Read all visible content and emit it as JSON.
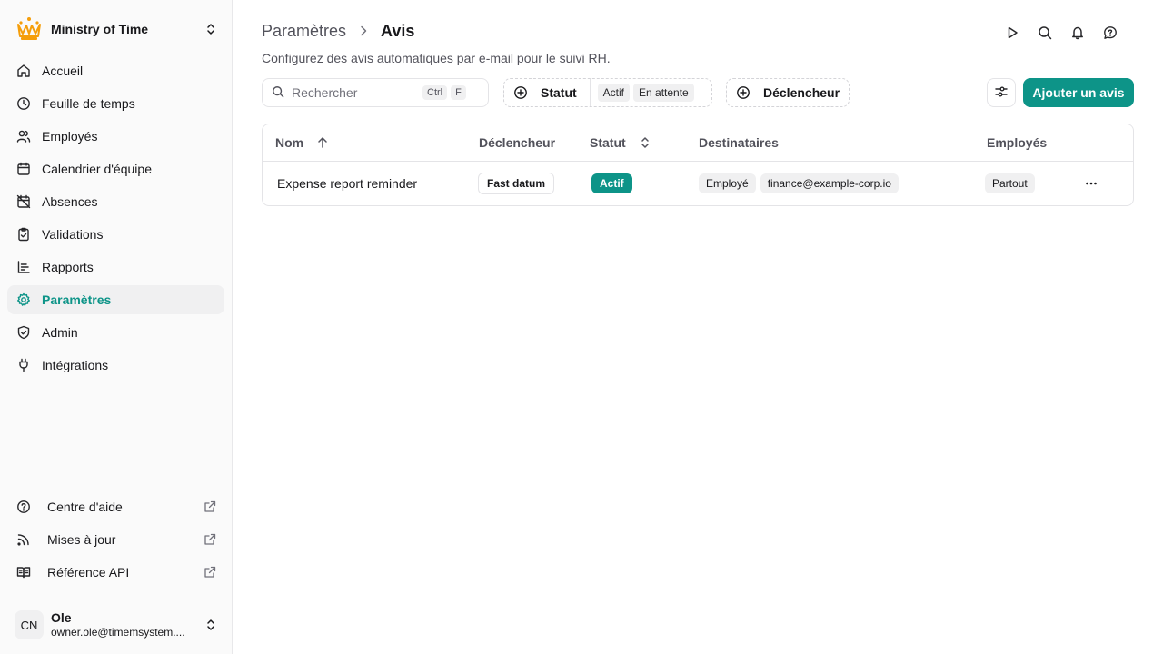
{
  "org": {
    "name": "Ministry of Time",
    "logo_icon": "crown-icon"
  },
  "sidebar": {
    "items": [
      {
        "label": "Accueil",
        "icon": "home-icon"
      },
      {
        "label": "Feuille de temps",
        "icon": "clock-icon"
      },
      {
        "label": "Employés",
        "icon": "users-icon"
      },
      {
        "label": "Calendrier d'équipe",
        "icon": "calendar-icon"
      },
      {
        "label": "Absences",
        "icon": "calendar-off-icon"
      },
      {
        "label": "Validations",
        "icon": "clipboard-check-icon"
      },
      {
        "label": "Rapports",
        "icon": "report-icon"
      },
      {
        "label": "Paramètres",
        "icon": "gear-icon",
        "active": true
      },
      {
        "label": "Admin",
        "icon": "shield-icon"
      },
      {
        "label": "Intégrations",
        "icon": "plug-icon"
      }
    ],
    "external": [
      {
        "label": "Centre d'aide",
        "icon": "help-circle-icon"
      },
      {
        "label": "Mises à jour",
        "icon": "rss-icon"
      },
      {
        "label": "Référence API",
        "icon": "book-icon"
      }
    ],
    "user": {
      "initials": "CN",
      "name": "Ole",
      "email": "owner.ole@timemsystem...."
    }
  },
  "header": {
    "breadcrumb_parent": "Paramètres",
    "title": "Avis",
    "subtitle": "Configurez des avis automatiques par e-mail pour le suivi RH."
  },
  "toolbar": {
    "search_placeholder": "Rechercher",
    "kbd_ctrl": "Ctrl",
    "kbd_f": "F",
    "status_filter_label": "Statut",
    "status_chips": [
      "Actif",
      "En attente"
    ],
    "trigger_filter_label": "Déclencheur",
    "add_button_label": "Ajouter un avis"
  },
  "table": {
    "columns": {
      "name": "Nom",
      "trigger": "Déclencheur",
      "status": "Statut",
      "recipients": "Destinataires",
      "employees": "Employés"
    },
    "rows": [
      {
        "name": "Expense report reminder",
        "trigger": "Fast datum",
        "status": "Actif",
        "recipients": [
          "Employé",
          "finance@example-corp.io"
        ],
        "employees": "Partout"
      }
    ]
  },
  "colors": {
    "accent": "#0d9488",
    "logo": "#f59e0b"
  }
}
